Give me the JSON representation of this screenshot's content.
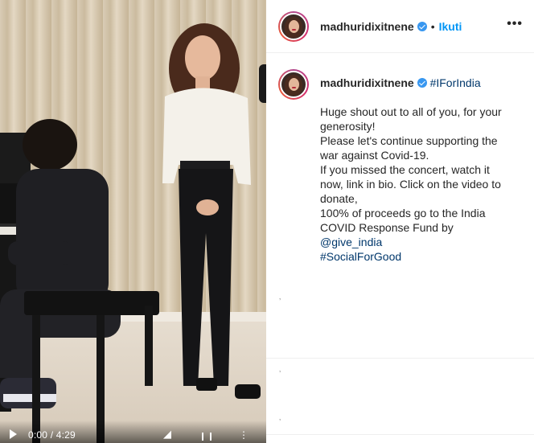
{
  "post": {
    "username": "madhuridixitnene",
    "follow_label": "Ikuti",
    "separator": "•",
    "more_label": "•••"
  },
  "caption": {
    "username": "madhuridixitnene",
    "hashtag": "#IForIndia",
    "lines": [
      "Huge shout out to all of you, for your",
      "generosity!",
      "Please let's continue supporting the",
      "war against Covid-19.",
      "If you missed the concert, watch it",
      "now, link in bio. Click on the video to",
      "donate,",
      "100% of proceeds go to the India"
    ],
    "last_line_prefix": "COVID Response Fund by ",
    "mention": "@give_india",
    "closing_hashtag": "#SocialForGood"
  },
  "video": {
    "time": "0:00 / 4:29",
    "progress": 0
  },
  "colors": {
    "verified": "#3897f0",
    "follow": "#0095f6",
    "link": "#00376b"
  },
  "icons": [
    "verified-badge-icon",
    "more-options-icon",
    "play-icon",
    "volume-icon",
    "fullscreen-icon",
    "video-menu-icon"
  ]
}
